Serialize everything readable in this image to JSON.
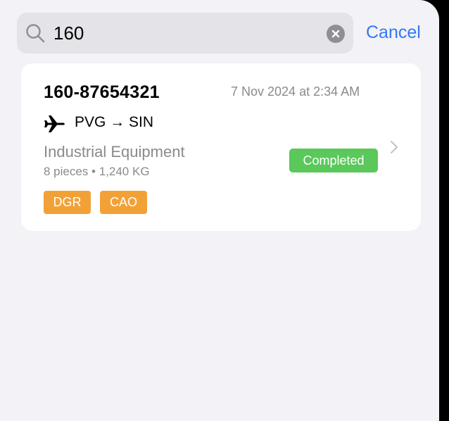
{
  "search": {
    "query": "160",
    "cancel_label": "Cancel",
    "icon": "magnifying-glass-icon",
    "clear_icon": "xmark-circle-icon"
  },
  "results": [
    {
      "awb": "160-87654321",
      "timestamp": "7 Nov 2024 at 2:34 AM",
      "route_icon": "airplane-icon",
      "route": "PVG → SIN",
      "commodity": "Industrial Equipment",
      "details": "8 pieces • 1,240 KG",
      "status": "Completed",
      "tags": [
        "DGR",
        "CAO"
      ],
      "disclosure_icon": "chevron-right-icon"
    }
  ],
  "colors": {
    "accent": "#3478f6",
    "status_completed": "#5ac85a",
    "tag": "#f2a137",
    "background": "#f2f2f7"
  }
}
